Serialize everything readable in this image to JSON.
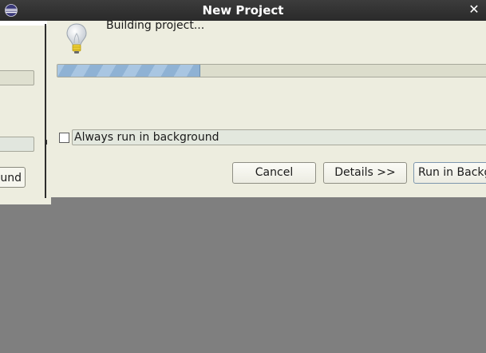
{
  "window": {
    "title": "New Project",
    "close_glyph": "✕",
    "app_icon": "eclipse-icon"
  },
  "background_dialog": {
    "button_label": "ound"
  },
  "progress_dialog": {
    "icon": "lightbulb-icon",
    "task_label": "Building project...",
    "progress_fraction": 0.33,
    "checkbox": {
      "label": "Always run in background",
      "checked": false
    },
    "buttons": {
      "cancel": "Cancel",
      "details": "Details >>",
      "run_in_background": "Run in Background"
    }
  },
  "colors": {
    "titlebar": "#2f2f2f",
    "dialog_bg": "#ededdf",
    "desktop_bg": "#7f7f7f",
    "progress_fill": "#8fb2d4"
  }
}
